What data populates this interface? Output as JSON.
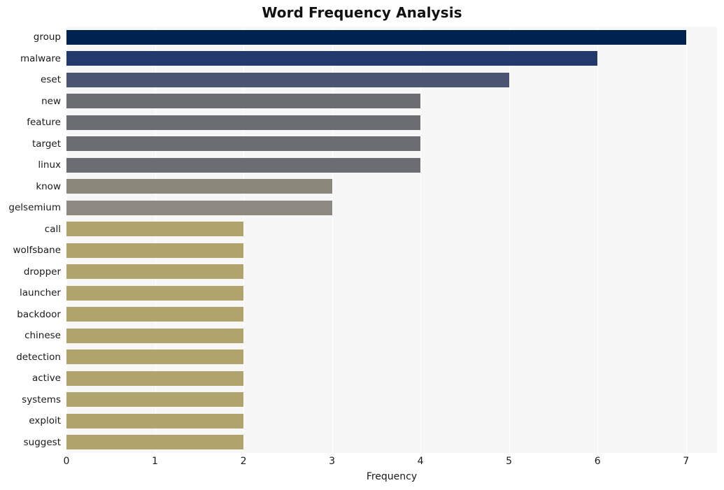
{
  "chart_data": {
    "type": "bar",
    "orientation": "horizontal",
    "title": "Word Frequency Analysis",
    "xlabel": "Frequency",
    "ylabel": "",
    "xlim": [
      0,
      7.35
    ],
    "ylim": [
      0,
      20
    ],
    "grid": true,
    "legend": false,
    "xticks": [
      "0",
      "1",
      "2",
      "3",
      "4",
      "5",
      "6",
      "7"
    ],
    "xtick_values": [
      0,
      1,
      2,
      3,
      4,
      5,
      6,
      7
    ],
    "categories": [
      "group",
      "malware",
      "eset",
      "new",
      "feature",
      "target",
      "linux",
      "know",
      "gelsemium",
      "call",
      "wolfsbane",
      "dropper",
      "launcher",
      "backdoor",
      "chinese",
      "detection",
      "active",
      "systems",
      "exploit",
      "suggest"
    ],
    "values": [
      7,
      6,
      5,
      4,
      4,
      4,
      4,
      3,
      3,
      2,
      2,
      2,
      2,
      2,
      2,
      2,
      2,
      2,
      2,
      2
    ],
    "colors": [
      "#00224e",
      "#23396e",
      "#4c5572",
      "#6b6d73",
      "#6b6d73",
      "#6b6d73",
      "#6b6d73",
      "#8b887b",
      "#8d8980",
      "#b0a46c",
      "#b0a46c",
      "#b0a46c",
      "#b0a46c",
      "#b0a46c",
      "#b0a46c",
      "#b0a46c",
      "#b0a46c",
      "#b0a46c",
      "#b0a46c",
      "#b0a46c"
    ],
    "plot_background": "#f7f7f7",
    "grid_color": "#ffffff",
    "figure_background": "#ffffff"
  }
}
